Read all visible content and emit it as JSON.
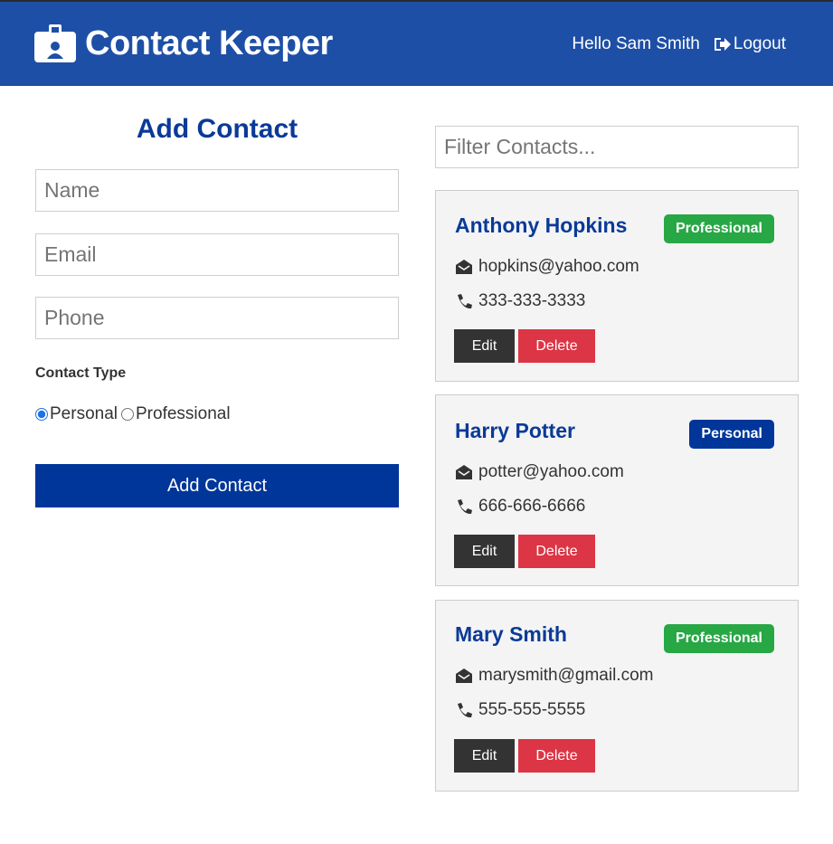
{
  "navbar": {
    "title": "Contact Keeper",
    "icon": "id-badge-icon",
    "greeting": "Hello Sam Smith",
    "logout_label": "Logout",
    "logout_icon": "sign-out-icon",
    "background": "#1e4fa6"
  },
  "form": {
    "title": "Add Contact",
    "name_placeholder": "Name",
    "email_placeholder": "Email",
    "phone_placeholder": "Phone",
    "contact_type_label": "Contact Type",
    "radio_personal": "Personal",
    "radio_professional": "Professional",
    "selected_type": "personal",
    "submit_label": "Add Contact"
  },
  "filter": {
    "placeholder": "Filter Contacts..."
  },
  "contacts": [
    {
      "name": "Anthony Hopkins",
      "type": "Professional",
      "email": "hopkins@yahoo.com",
      "phone": "333-333-3333",
      "edit_label": "Edit",
      "delete_label": "Delete"
    },
    {
      "name": "Harry Potter",
      "type": "Personal",
      "email": "potter@yahoo.com",
      "phone": "666-666-6666",
      "edit_label": "Edit",
      "delete_label": "Delete"
    },
    {
      "name": "Mary Smith",
      "type": "Professional",
      "email": "marysmith@gmail.com",
      "phone": "555-555-5555",
      "edit_label": "Edit",
      "delete_label": "Delete"
    }
  ],
  "colors": {
    "primary": "#003699",
    "professional": "#28a745",
    "personal": "#003699",
    "danger": "#dc3545",
    "dark": "#333333",
    "card_bg": "#f4f4f4"
  }
}
